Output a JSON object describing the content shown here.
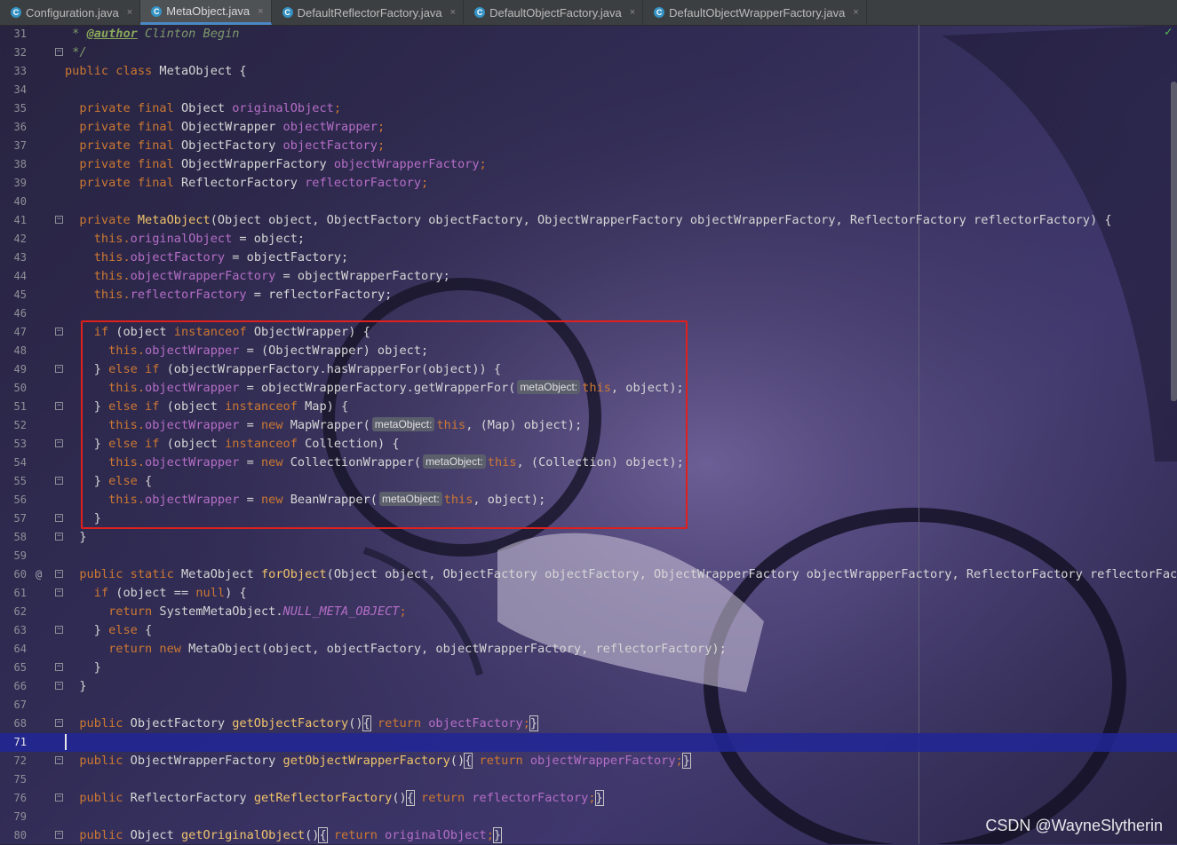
{
  "tabs": [
    {
      "label": "Configuration.java",
      "active": false
    },
    {
      "label": "MetaObject.java",
      "active": true
    },
    {
      "label": "DefaultReflectorFactory.java",
      "active": false
    },
    {
      "label": "DefaultObjectFactory.java",
      "active": false
    },
    {
      "label": "DefaultObjectWrapperFactory.java",
      "active": false
    }
  ],
  "tab_icon_letter": "C",
  "tab_close_glyph": "×",
  "status_check": "✓",
  "watermark": "CSDN @WayneSlytherin",
  "current_line": "71",
  "hint_label": "metaObject:",
  "line_numbers": [
    "31",
    "32",
    "33",
    "34",
    "35",
    "36",
    "37",
    "38",
    "39",
    "40",
    "41",
    "42",
    "43",
    "44",
    "45",
    "46",
    "47",
    "48",
    "49",
    "50",
    "51",
    "52",
    "53",
    "54",
    "55",
    "56",
    "57",
    "58",
    "59",
    "60",
    "61",
    "62",
    "63",
    "64",
    "65",
    "66",
    "67",
    "68",
    "71",
    "72",
    "75",
    "76",
    "79",
    "80"
  ],
  "code": {
    "l31": {
      "star": " * ",
      "tag": "@author",
      "rest": " Clinton Begin"
    },
    "l32": " */",
    "l33": {
      "kw": "public class ",
      "rest": "MetaObject {"
    },
    "l35": {
      "kw": "  private final ",
      "type": "Object ",
      "fld": "originalObject",
      "end": ";"
    },
    "l36": {
      "kw": "  private final ",
      "type": "ObjectWrapper ",
      "fld": "objectWrapper",
      "end": ";"
    },
    "l37": {
      "kw": "  private final ",
      "type": "ObjectFactory ",
      "fld": "objectFactory",
      "end": ";"
    },
    "l38": {
      "kw": "  private final ",
      "type": "ObjectWrapperFactory ",
      "fld": "objectWrapperFactory",
      "end": ";"
    },
    "l39": {
      "kw": "  private final ",
      "type": "ReflectorFactory ",
      "fld": "reflectorFactory",
      "end": ";"
    },
    "l41": {
      "kw": "  private ",
      "fn": "MetaObject",
      "rest": "(Object object, ObjectFactory objectFactory, ObjectWrapperFactory objectWrapperFactory, ReflectorFactory reflectorFactory) {"
    },
    "l42": {
      "kw": "    this.",
      "fld": "originalObject",
      "rest": " = object;"
    },
    "l43": {
      "kw": "    this.",
      "fld": "objectFactory",
      "rest": " = objectFactory;"
    },
    "l44": {
      "kw": "    this.",
      "fld": "objectWrapperFactory",
      "rest": " = objectWrapperFactory;"
    },
    "l45": {
      "kw": "    this.",
      "fld": "reflectorFactory",
      "rest": " = reflectorFactory;"
    },
    "l47": {
      "a": "    ",
      "kw1": "if",
      "b": " (object ",
      "kw2": "instanceof",
      "c": " ObjectWrapper) {"
    },
    "l48": {
      "kw": "      this.",
      "fld": "objectWrapper",
      "rest": " = (ObjectWrapper) object;"
    },
    "l49": {
      "a": "    } ",
      "kw1": "else if",
      "rest": " (objectWrapperFactory.hasWrapperFor(object)) {"
    },
    "l50": {
      "kw": "      this.",
      "fld": "objectWrapper",
      "mid": " = objectWrapperFactory.getWrapperFor(",
      "kw2": "this",
      "rest": ", object);"
    },
    "l51": {
      "a": "    } ",
      "kw1": "else if",
      "b": " (object ",
      "kw2": "instanceof",
      "c": " Map) {"
    },
    "l52": {
      "kw": "      this.",
      "fld": "objectWrapper",
      "mid": " = ",
      "kwnew": "new",
      "mid2": " MapWrapper(",
      "kw2": "this",
      "rest": ", (Map) object);"
    },
    "l53": {
      "a": "    } ",
      "kw1": "else if",
      "b": " (object ",
      "kw2": "instanceof",
      "c": " Collection) {"
    },
    "l54": {
      "kw": "      this.",
      "fld": "objectWrapper",
      "mid": " = ",
      "kwnew": "new",
      "mid2": " CollectionWrapper(",
      "kw2": "this",
      "rest": ", (Collection) object);"
    },
    "l55": {
      "a": "    } ",
      "kw1": "else",
      "c": " {"
    },
    "l56": {
      "kw": "      this.",
      "fld": "objectWrapper",
      "mid": " = ",
      "kwnew": "new",
      "mid2": " BeanWrapper(",
      "kw2": "this",
      "rest": ", object);"
    },
    "l57": "    }",
    "l58": "  }",
    "l60": {
      "kw": "  public static ",
      "type": "MetaObject ",
      "fn": "forObject",
      "rest": "(Object object, ObjectFactory objectFactory, ObjectWrapperFactory objectWrapperFactory, ReflectorFactory reflectorFactory"
    },
    "l61": {
      "a": "    ",
      "kw1": "if",
      "b": " (object == ",
      "kw2": "null",
      "c": ") {"
    },
    "l62": {
      "kw": "      return ",
      "type": "SystemMetaObject.",
      "stat": "NULL_META_OBJECT",
      "end": ";"
    },
    "l63": {
      "a": "    } ",
      "kw1": "else",
      "c": " {"
    },
    "l64": {
      "kw": "      return new ",
      "rest": "MetaObject(object, objectFactory, objectWrapperFactory, reflectorFactory);"
    },
    "l65": "    }",
    "l66": "  }",
    "l68": {
      "kw": "  public ",
      "type": "ObjectFactory ",
      "fn": "getObjectFactory",
      "paren": "()",
      "lb": "{",
      "kw2": " return ",
      "fld": "objectFactory",
      "end": ";",
      "rb": "}"
    },
    "l72": {
      "kw": "  public ",
      "type": "ObjectWrapperFactory ",
      "fn": "getObjectWrapperFactory",
      "paren": "()",
      "lb": "{",
      "kw2": " return ",
      "fld": "objectWrapperFactory",
      "end": ";",
      "rb": "}"
    },
    "l76": {
      "kw": "  public ",
      "type": "ReflectorFactory ",
      "fn": "getReflectorFactory",
      "paren": "()",
      "lb": "{",
      "kw2": " return ",
      "fld": "reflectorFactory",
      "end": ";",
      "rb": "}"
    },
    "l80": {
      "kw": "  public ",
      "type": "Object ",
      "fn": "getOriginalObject",
      "paren": "()",
      "lb": "{",
      "kw2": " return ",
      "fld": "originalObject",
      "end": ";",
      "rb": "}"
    }
  },
  "gutter_annotation": "@",
  "fold_glyph": "−",
  "colors": {
    "keyword": "#cc7832",
    "field": "#b56ec7",
    "method": "#f0c36a",
    "highlight_box": "#e0201c",
    "current_line": "#21269a"
  }
}
